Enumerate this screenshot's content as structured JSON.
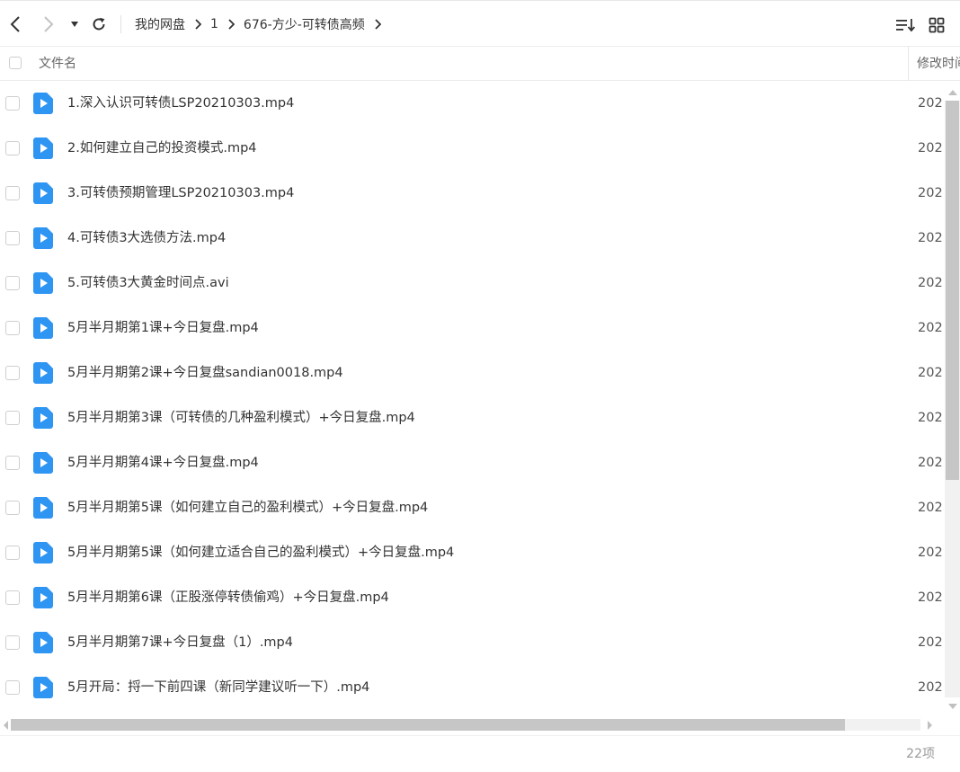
{
  "toolbar": {
    "breadcrumb": [
      "我的网盘",
      "1",
      "676-方少-可转债高频"
    ]
  },
  "header": {
    "name_column": "文件名",
    "mtime_column": "修改时间"
  },
  "files": [
    {
      "name": "1.深入认识可转债LSP20210303.mp4",
      "mtime": "202"
    },
    {
      "name": "2.如何建立自己的投资模式.mp4",
      "mtime": "202"
    },
    {
      "name": "3.可转债预期管理LSP20210303.mp4",
      "mtime": "202"
    },
    {
      "name": "4.可转债3大选债方法.mp4",
      "mtime": "202"
    },
    {
      "name": "5.可转债3大黄金时间点.avi",
      "mtime": "202"
    },
    {
      "name": "5月半月期第1课+今日复盘.mp4",
      "mtime": "202"
    },
    {
      "name": "5月半月期第2课+今日复盘sandian0018.mp4",
      "mtime": "202"
    },
    {
      "name": "5月半月期第3课（可转债的几种盈利模式）+今日复盘.mp4",
      "mtime": "202"
    },
    {
      "name": "5月半月期第4课+今日复盘.mp4",
      "mtime": "202"
    },
    {
      "name": "5月半月期第5课（如何建立自己的盈利模式）+今日复盘.mp4",
      "mtime": "202"
    },
    {
      "name": "5月半月期第5课（如何建立适合自己的盈利模式）+今日复盘.mp4",
      "mtime": "202"
    },
    {
      "name": "5月半月期第6课（正股涨停转债偷鸡）+今日复盘.mp4",
      "mtime": "202"
    },
    {
      "name": "5月半月期第7课+今日复盘（1）.mp4",
      "mtime": "202"
    },
    {
      "name": "5月开局：捋一下前四课（新同学建议听一下）.mp4",
      "mtime": "202"
    }
  ],
  "status": {
    "item_count": "22项"
  },
  "colors": {
    "video_icon": "#2f95f2",
    "scrollbar_thumb": "#c6c6c6"
  }
}
